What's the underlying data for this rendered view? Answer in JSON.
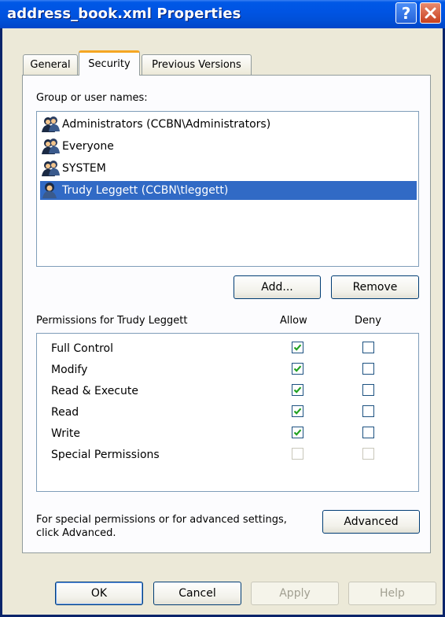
{
  "window": {
    "title": "address_book.xml Properties",
    "help_label": "?",
    "close_label": "X"
  },
  "tabs": [
    {
      "label": "General",
      "active": false
    },
    {
      "label": "Security",
      "active": true
    },
    {
      "label": "Previous Versions",
      "active": false
    }
  ],
  "security": {
    "users_label": "Group or user names:",
    "users": [
      {
        "name": "Administrators (CCBN\\Administrators)",
        "icon": "group-icon",
        "selected": false
      },
      {
        "name": "Everyone",
        "icon": "group-icon",
        "selected": false
      },
      {
        "name": "SYSTEM",
        "icon": "group-icon",
        "selected": false
      },
      {
        "name": "Trudy Leggett (CCBN\\tleggett)",
        "icon": "user-icon",
        "selected": true
      }
    ],
    "add_label": "Add...",
    "remove_label": "Remove",
    "permissions_label": "Permissions for Trudy Leggett",
    "allow_label": "Allow",
    "deny_label": "Deny",
    "permissions": [
      {
        "name": "Full Control",
        "allow": true,
        "deny": false,
        "enabled": true
      },
      {
        "name": "Modify",
        "allow": true,
        "deny": false,
        "enabled": true
      },
      {
        "name": "Read & Execute",
        "allow": true,
        "deny": false,
        "enabled": true
      },
      {
        "name": "Read",
        "allow": true,
        "deny": false,
        "enabled": true
      },
      {
        "name": "Write",
        "allow": true,
        "deny": false,
        "enabled": true
      },
      {
        "name": "Special Permissions",
        "allow": false,
        "deny": false,
        "enabled": false
      }
    ],
    "advanced_text_line1": "For special permissions or for advanced settings,",
    "advanced_text_line2": "click Advanced.",
    "advanced_label": "Advanced"
  },
  "footer": {
    "ok_label": "OK",
    "cancel_label": "Cancel",
    "apply_label": "Apply",
    "help_label": "Help"
  },
  "colors": {
    "titlebar": "#0054e3",
    "selection": "#316ac5",
    "check": "#21a121",
    "tab_highlight": "#f5a623"
  }
}
